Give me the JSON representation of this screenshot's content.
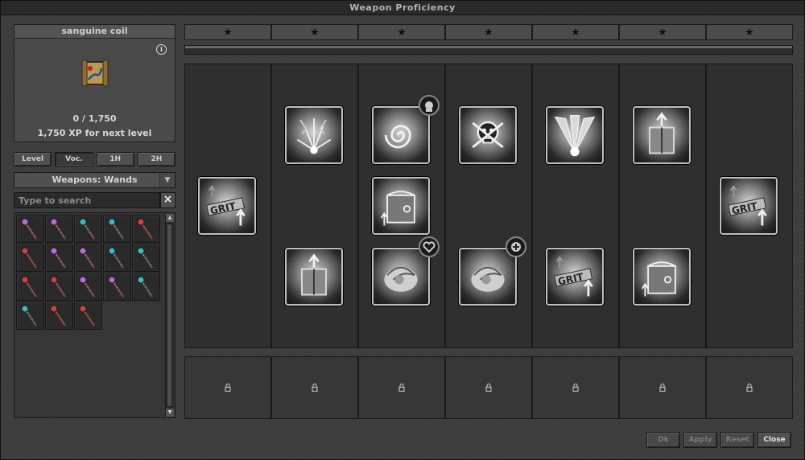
{
  "window": {
    "title": "Weapon Proficiency"
  },
  "item": {
    "name": "sanguine coil",
    "progress": "0 / 1,750",
    "next_level": "1,750 XP for next level",
    "xp_current": 0,
    "xp_max": 1750
  },
  "filter_buttons": [
    "Level",
    "Voc.",
    "1H",
    "2H"
  ],
  "category": {
    "selected": "Weapons: Wands"
  },
  "search": {
    "placeholder": "Type to search",
    "value": ""
  },
  "inventory": {
    "items": [
      {
        "color": "#b86bd6"
      },
      {
        "color": "#b86bd6"
      },
      {
        "color": "#3fb8c2"
      },
      {
        "color": "#3fb8c2"
      },
      {
        "color": "#d04040"
      },
      {
        "color": "#c04848"
      },
      {
        "color": "#b86bd6"
      },
      {
        "color": "#b86bd6"
      },
      {
        "color": "#3fb8c2"
      },
      {
        "color": "#3fb8c2"
      },
      {
        "color": "#d04040"
      },
      {
        "color": "#c04848"
      },
      {
        "color": "#b86bd6"
      },
      {
        "color": "#b86bd6"
      },
      {
        "color": "#3fb8c2"
      },
      {
        "color": "#3fb8c2"
      },
      {
        "color": "#d04040"
      },
      {
        "color": "#c04848"
      }
    ]
  },
  "tiers": {
    "stars": [
      "★",
      "★",
      "★",
      "★",
      "★",
      "★",
      "★"
    ]
  },
  "progress_bar": {
    "fraction": 0
  },
  "perk_columns": [
    {
      "perks": [
        {
          "icon": "grit-up-icon",
          "row": 1
        }
      ]
    },
    {
      "perks": [
        {
          "icon": "cracked-burst-icon",
          "row": 0
        },
        {
          "icon": "spellbook-up-icon",
          "row": 2
        }
      ]
    },
    {
      "perks": [
        {
          "icon": "spiral-aura-icon",
          "row": 0,
          "badge": "skull-badge-icon"
        },
        {
          "icon": "spellbook-chain-icon",
          "row": 1
        },
        {
          "icon": "vortex-icon",
          "row": 2,
          "badge": "heart-badge-icon"
        }
      ]
    },
    {
      "perks": [
        {
          "icon": "skull-crossbones-icon",
          "row": 0
        },
        {
          "icon": "vortex-icon",
          "row": 2,
          "badge": "plus-badge-icon"
        }
      ]
    },
    {
      "perks": [
        {
          "icon": "light-burst-icon",
          "row": 0
        },
        {
          "icon": "grit-up-icon",
          "row": 2
        }
      ]
    },
    {
      "perks": [
        {
          "icon": "spellbook-up-icon",
          "row": 0
        },
        {
          "icon": "spellbook-chain-icon",
          "row": 2
        }
      ]
    },
    {
      "perks": [
        {
          "icon": "grit-up-icon",
          "row": 1
        }
      ]
    }
  ],
  "slot_locks": [
    "lock-icon",
    "lock-icon",
    "lock-icon",
    "lock-icon",
    "lock-icon",
    "lock-icon",
    "lock-icon"
  ],
  "footer": {
    "ok": "Ok",
    "apply": "Apply",
    "reset": "Reset",
    "close": "Close"
  }
}
